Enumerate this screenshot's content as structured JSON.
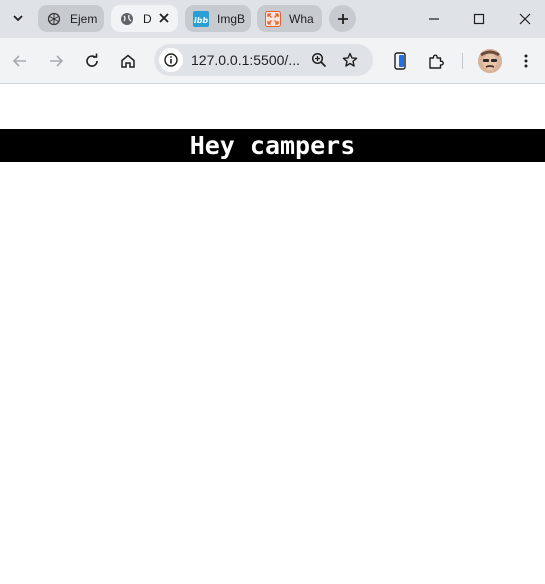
{
  "browser": {
    "tabs": [
      {
        "title": "Ejem",
        "icon": "openai-icon",
        "active": false
      },
      {
        "title": "D",
        "icon": "globe-icon",
        "active": true
      },
      {
        "title": "ImgB",
        "icon": "imgbb-icon",
        "active": false
      },
      {
        "title": "Wha",
        "icon": "expand-icon",
        "active": false
      }
    ],
    "address_bar": {
      "url": "127.0.0.1:5500/..."
    },
    "colors": {
      "tabbar": "#dfe3e7",
      "toolbar": "#f1f3f4",
      "accent": "#1a73e8"
    }
  },
  "page": {
    "heading": "Hey campers",
    "heading_colors": {
      "background": "#000000",
      "text": "#ffffff"
    }
  }
}
